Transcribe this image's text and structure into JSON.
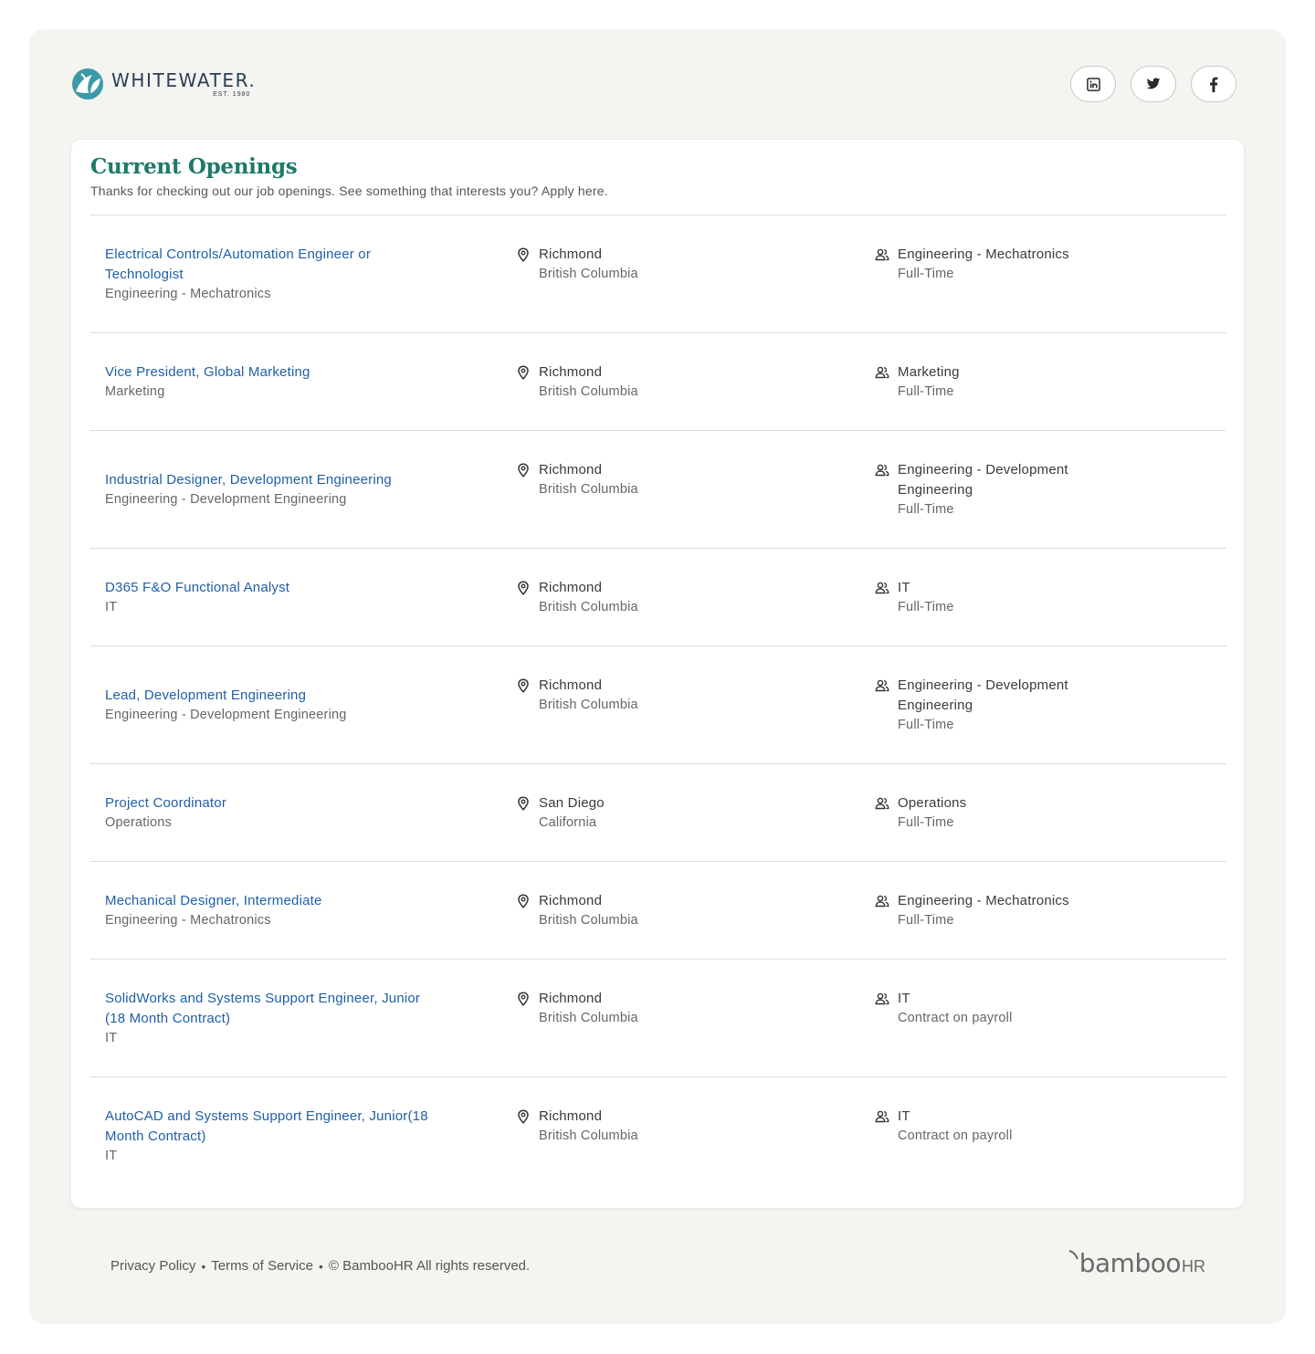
{
  "brand": {
    "name": "WHITEWATER",
    "name_suffix": ".",
    "est": "EST. 1980",
    "accent_color": "#1e7a67",
    "link_color": "#1f5fa6"
  },
  "socials": [
    {
      "name": "linkedin",
      "icon": "linkedin-icon"
    },
    {
      "name": "twitter",
      "icon": "twitter-icon"
    },
    {
      "name": "facebook",
      "icon": "facebook-icon"
    }
  ],
  "openings": {
    "title": "Current Openings",
    "subtitle": "Thanks for checking out our job openings. See something that interests you? Apply here.",
    "jobs": [
      {
        "title_lines": [
          "Electrical Controls/Automation Engineer or",
          "Technologist"
        ],
        "department": "Engineering - Mechatronics",
        "city": "Richmond",
        "region": "British Columbia",
        "team_lines": [
          "Engineering - Mechatronics"
        ],
        "type": "Full-Time"
      },
      {
        "title_lines": [
          "Vice President, Global Marketing"
        ],
        "department": "Marketing",
        "city": "Richmond",
        "region": "British Columbia",
        "team_lines": [
          "Marketing"
        ],
        "type": "Full-Time"
      },
      {
        "title_lines": [
          "Industrial Designer, Development Engineering"
        ],
        "department": "Engineering - Development Engineering",
        "city": "Richmond",
        "region": "British Columbia",
        "team_lines": [
          "Engineering - Development",
          "Engineering"
        ],
        "type": "Full-Time"
      },
      {
        "title_lines": [
          "D365 F&O Functional Analyst"
        ],
        "department": "IT",
        "city": "Richmond",
        "region": "British Columbia",
        "team_lines": [
          "IT"
        ],
        "type": "Full-Time"
      },
      {
        "title_lines": [
          "Lead, Development Engineering"
        ],
        "department": "Engineering - Development Engineering",
        "city": "Richmond",
        "region": "British Columbia",
        "team_lines": [
          "Engineering - Development",
          "Engineering"
        ],
        "type": "Full-Time"
      },
      {
        "title_lines": [
          "Project Coordinator"
        ],
        "department": "Operations",
        "city": "San Diego",
        "region": "California",
        "team_lines": [
          "Operations"
        ],
        "type": "Full-Time"
      },
      {
        "title_lines": [
          "Mechanical Designer, Intermediate"
        ],
        "department": "Engineering - Mechatronics",
        "city": "Richmond",
        "region": "British Columbia",
        "team_lines": [
          "Engineering - Mechatronics"
        ],
        "type": "Full-Time"
      },
      {
        "title_lines": [
          "SolidWorks and Systems Support Engineer, Junior",
          "(18 Month Contract)"
        ],
        "department": "IT",
        "city": "Richmond",
        "region": "British Columbia",
        "team_lines": [
          "IT"
        ],
        "type": "Contract on payroll"
      },
      {
        "title_lines": [
          "AutoCAD and Systems Support Engineer, Junior(18",
          "Month Contract)"
        ],
        "department": "IT",
        "city": "Richmond",
        "region": "British Columbia",
        "team_lines": [
          "IT"
        ],
        "type": "Contract on payroll"
      }
    ]
  },
  "footer": {
    "privacy": "Privacy Policy",
    "terms": "Terms of Service",
    "copyright": "© BambooHR All rights reserved.",
    "separator": "•",
    "powered_by": "bamboo",
    "powered_by_suffix": "HR"
  }
}
